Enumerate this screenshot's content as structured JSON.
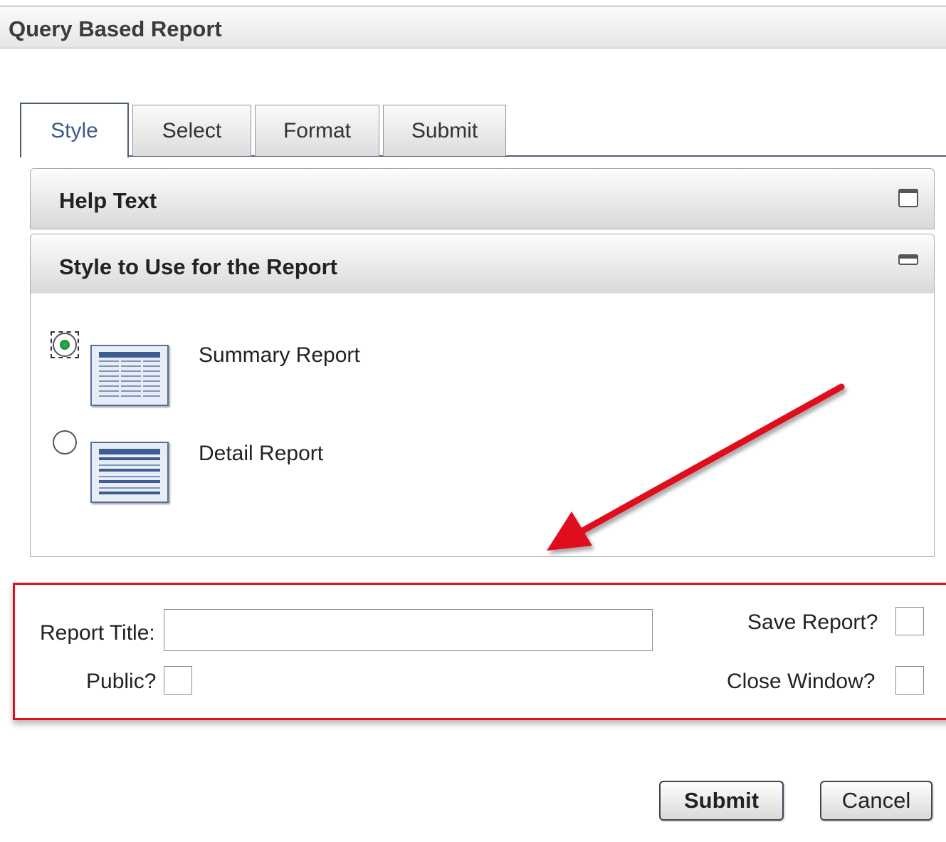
{
  "window": {
    "title": "Query Based Report"
  },
  "tabs": [
    {
      "label": "Style",
      "active": true
    },
    {
      "label": "Select",
      "active": false
    },
    {
      "label": "Format",
      "active": false
    },
    {
      "label": "Submit",
      "active": false
    }
  ],
  "panels": {
    "help": {
      "title": "Help Text",
      "icon": "maximize-icon"
    },
    "style": {
      "title": "Style to Use for the Report",
      "icon": "minimize-icon"
    }
  },
  "report_styles": [
    {
      "label": "Summary Report",
      "selected": true,
      "icon": "summary-report-thumbnail"
    },
    {
      "label": "Detail Report",
      "selected": false,
      "icon": "detail-report-thumbnail"
    }
  ],
  "form": {
    "report_title_label": "Report Title:",
    "report_title_value": "",
    "public_label": "Public?",
    "public_checked": false,
    "save_report_label": "Save Report?",
    "save_report_checked": false,
    "close_window_label": "Close Window?",
    "close_window_checked": false
  },
  "buttons": {
    "submit": "Submit",
    "cancel": "Cancel"
  },
  "annotation": {
    "highlight_color": "#e0101a"
  }
}
